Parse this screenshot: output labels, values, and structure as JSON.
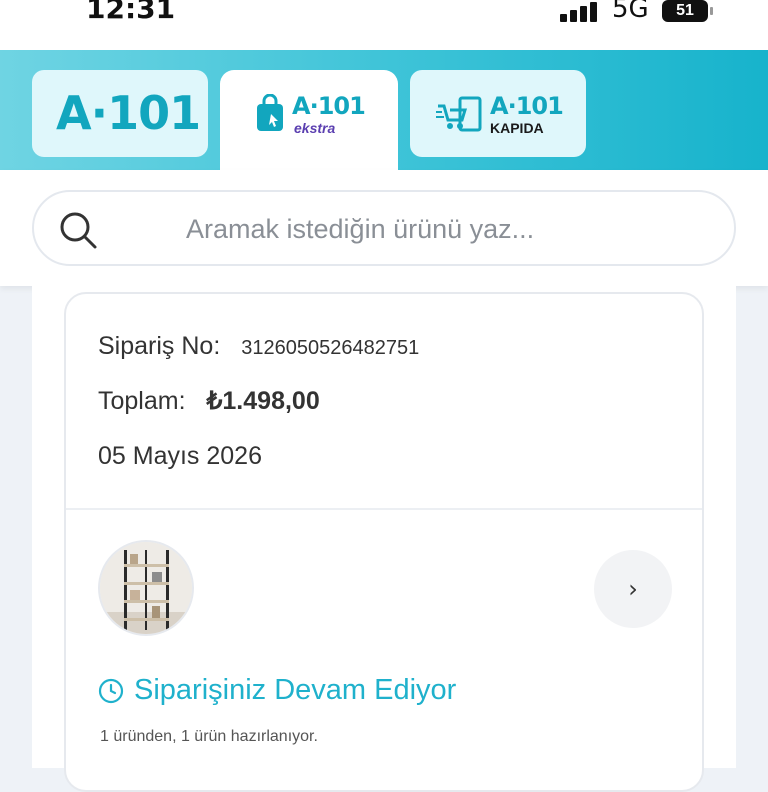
{
  "status_bar": {
    "time": "12:31",
    "network": "5G",
    "battery": "51"
  },
  "brand_tabs": {
    "a101": "A·101",
    "ekstra": {
      "brand": "A·101",
      "sub": "ekstra"
    },
    "kapida": {
      "brand": "A·101",
      "sub": "KAPIDA"
    }
  },
  "search": {
    "placeholder": "Aramak istediğin ürünü yaz..."
  },
  "order": {
    "order_no_label": "Sipariş No:",
    "order_no": "3126050526482751",
    "total_label": "Toplam:",
    "total": "₺1.498,00",
    "date": "05 Mayıs 2026",
    "status": "Siparişiniz Devam Ediyor",
    "progress_text": "1 üründen, 1 ürün hazırlanıyor."
  },
  "colors": {
    "brand_teal": "#17b3cc",
    "status_teal": "#1fb1cc",
    "ekstra_purple": "#5b3fb0"
  },
  "icons": [
    "signal-icon",
    "battery-icon",
    "shopping-bag-icon",
    "cart-door-icon",
    "search-icon",
    "chevron-right-icon",
    "clock-icon"
  ]
}
